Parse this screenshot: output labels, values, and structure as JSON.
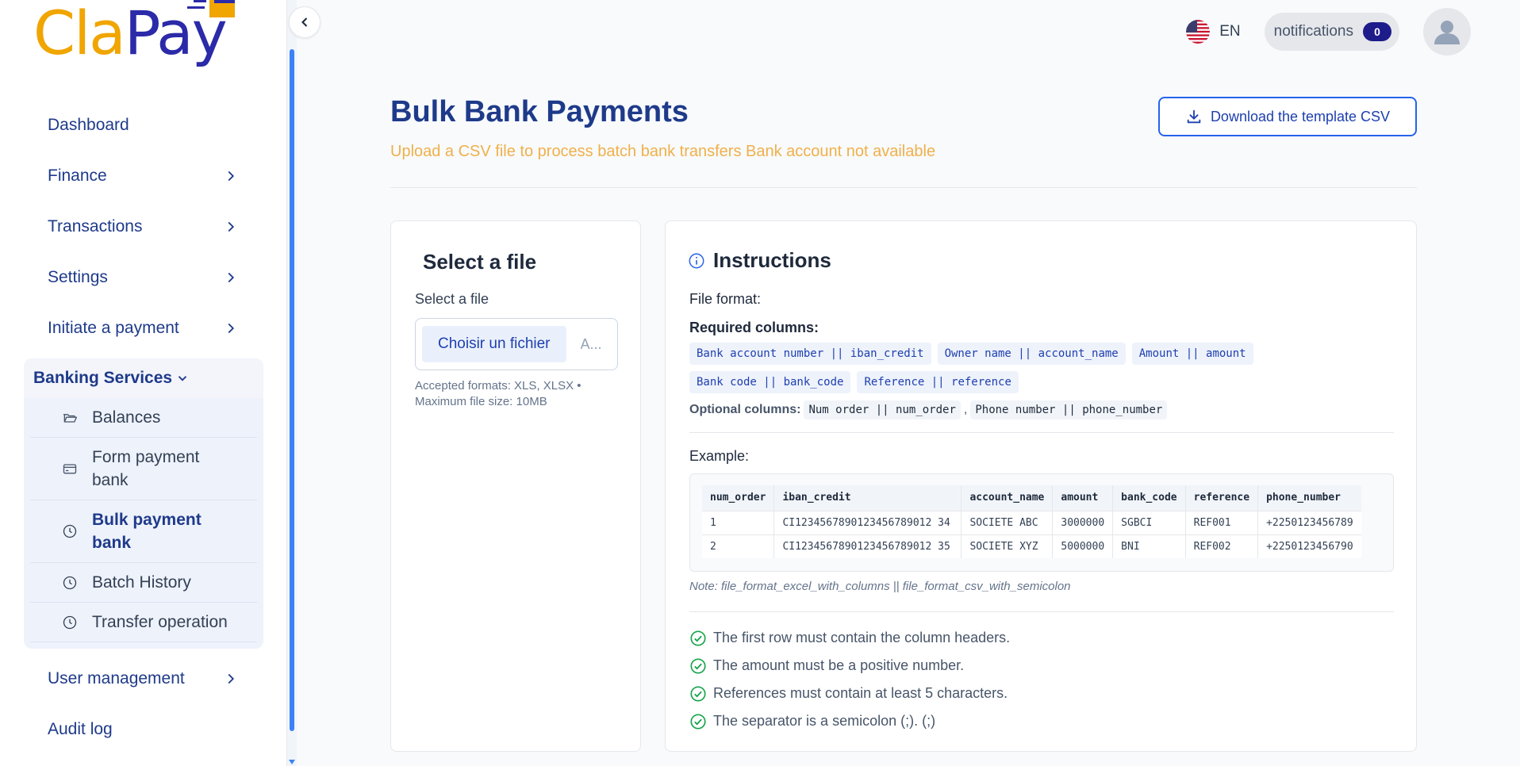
{
  "brand": {
    "name_part1": "Cla",
    "name_part2": "Pay"
  },
  "sidebar": {
    "items": [
      {
        "label": "Dashboard",
        "has_chevron": false
      },
      {
        "label": "Finance",
        "has_chevron": true
      },
      {
        "label": "Transactions",
        "has_chevron": true
      },
      {
        "label": "Settings",
        "has_chevron": true
      },
      {
        "label": "Initiate a payment",
        "has_chevron": true
      }
    ],
    "group": {
      "label": "Banking Services",
      "subitems": [
        {
          "label": "Balances",
          "icon": "folder-open-icon"
        },
        {
          "label": "Form payment bank",
          "icon": "credit-card-icon"
        },
        {
          "label": "Bulk payment bank",
          "icon": "clock-icon",
          "active": true
        },
        {
          "label": "Batch History",
          "icon": "clock-icon"
        },
        {
          "label": "Transfer operation",
          "icon": "clock-icon"
        }
      ]
    },
    "after": [
      {
        "label": "User management",
        "has_chevron": true
      },
      {
        "label": "Audit log",
        "has_chevron": false
      }
    ]
  },
  "topbar": {
    "lang": "EN",
    "notifications_label": "notifications",
    "notifications_count": "0"
  },
  "page": {
    "title": "Bulk Bank Payments",
    "subtitle": "Upload a CSV file to process batch bank transfers Bank account not available",
    "download_label": "Download the template CSV"
  },
  "file_card": {
    "title": "Select a file",
    "label": "Select a file",
    "button": "Choisir un fichier",
    "file_name": "A...",
    "hint": "Accepted formats: XLS, XLSX • Maximum file size: 10MB"
  },
  "instructions": {
    "title": "Instructions",
    "file_format": "File format:",
    "required_label": "Required columns:",
    "required": [
      "Bank account number || iban_credit",
      "Owner name || account_name",
      "Amount || amount",
      "Bank code || bank_code",
      "Reference || reference"
    ],
    "optional_label": "Optional columns:",
    "optional": [
      "Num order || num_order",
      "Phone number || phone_number"
    ],
    "optional_sep": ",",
    "example_label": "Example:",
    "table": {
      "headers": [
        "num_order",
        "iban_credit",
        "account_name",
        "amount",
        "bank_code",
        "reference",
        "phone_number"
      ],
      "rows": [
        [
          "1",
          "CI1234567890123456789012 34",
          "SOCIETE ABC",
          "3000000",
          "SGBCI",
          "REF001",
          "+2250123456789"
        ],
        [
          "2",
          "CI1234567890123456789012 35",
          "SOCIETE XYZ",
          "5000000",
          "BNI",
          "REF002",
          "+2250123456790"
        ]
      ]
    },
    "note": "Note: file_format_excel_with_columns || file_format_csv_with_semicolon",
    "rules": [
      "The first row must contain the column headers.",
      "The amount must be a positive number.",
      "References must contain at least 5 characters.",
      "The separator is a semicolon (;). (;)"
    ]
  },
  "colors": {
    "primary": "#1e3a8a",
    "accent": "#f0a500",
    "check": "#16a34a"
  }
}
